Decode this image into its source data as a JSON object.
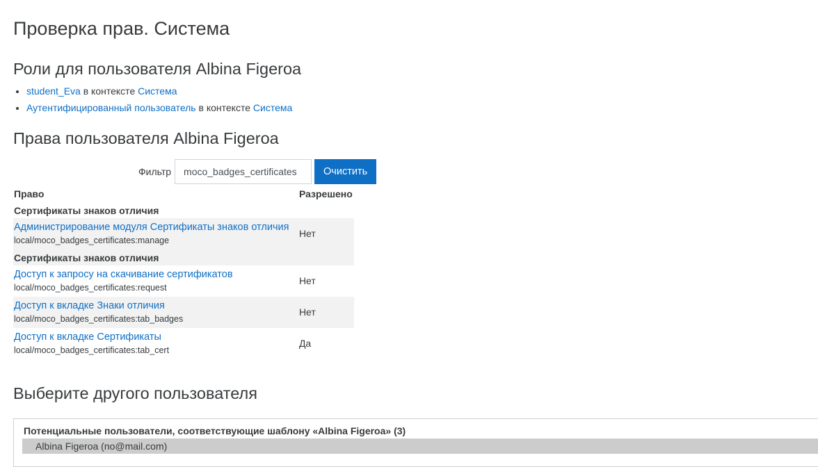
{
  "page": {
    "title": "Проверка прав. Система"
  },
  "roles": {
    "heading": "Роли для пользователя Albina Figeroa",
    "items": [
      {
        "role": "student_Eva",
        "connector": " в контексте ",
        "context": "Система"
      },
      {
        "role": "Аутентифицированный пользователь",
        "connector": " в контексте ",
        "context": "Система"
      }
    ]
  },
  "permissions": {
    "heading": "Права пользователя Albina Figeroa",
    "filter": {
      "label": "Фильтр",
      "value": "moco_badges_certificates",
      "clear_label": "Очистить"
    },
    "columns": {
      "capability": "Право",
      "allowed": "Разрешено"
    },
    "rows": [
      {
        "group": "Сертификаты знаков отличия"
      },
      {
        "name": "Администрирование модуля Сертификаты знаков отличия",
        "code": "local/moco_badges_certificates:manage",
        "allowed": "Нет"
      },
      {
        "group": "Сертификаты знаков отличия"
      },
      {
        "name": "Доступ к запросу на скачивание сертификатов",
        "code": "local/moco_badges_certificates:request",
        "allowed": "Нет"
      },
      {
        "name": "Доступ к вкладке Знаки отличия",
        "code": "local/moco_badges_certificates:tab_badges",
        "allowed": "Нет"
      },
      {
        "name": "Доступ к вкладке Сертификаты",
        "code": "local/moco_badges_certificates:tab_cert",
        "allowed": "Да"
      }
    ]
  },
  "other_user": {
    "heading": "Выберите другого пользователя",
    "legend": "Потенциальные пользователи, соответствующие шаблону «Albina Figeroa» (3)",
    "options": [
      "Albina Figeroa (no@mail.com)"
    ]
  },
  "colors": {
    "link": "#0f6fc5",
    "button": "#0f6fc5",
    "row_shade": "#f2f2f2",
    "selected_option": "#cccccc"
  }
}
